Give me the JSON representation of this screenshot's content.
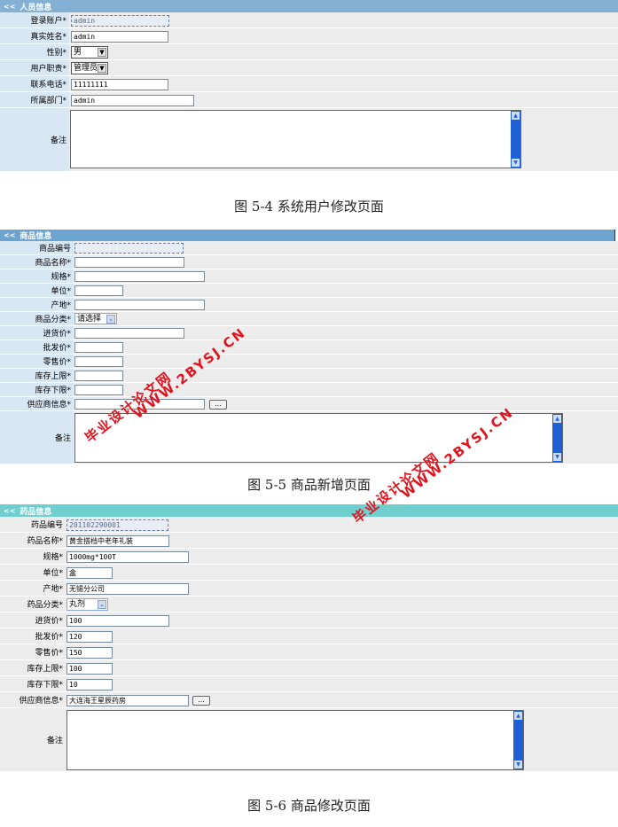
{
  "colors": {
    "header1": "#84b0d3",
    "header2": "#6aa4cf",
    "header3": "#6fcfce",
    "label_bg": "#d7e7f4",
    "value_bg": "#ececec",
    "watermark": "#e0141e"
  },
  "panel1": {
    "title": "人员信息",
    "chevron": "<<",
    "fields": {
      "login": {
        "label": "登录账户*",
        "value": "admin"
      },
      "realname": {
        "label": "真实姓名*",
        "value": "admin"
      },
      "gender": {
        "label": "性别*",
        "value": "男"
      },
      "role": {
        "label": "用户职责*",
        "value": "管理员"
      },
      "phone": {
        "label": "联系电话*",
        "value": "11111111"
      },
      "dept": {
        "label": "所属部门*",
        "value": "admin"
      },
      "remark": {
        "label": "备注"
      }
    }
  },
  "caption1": "图 5-4  系统用户修改页面",
  "panel2": {
    "title": "商品信息",
    "chevron": "<<",
    "fields": {
      "code": {
        "label": "商品编号"
      },
      "name": {
        "label": "商品名称*"
      },
      "spec": {
        "label": "规格*"
      },
      "unit": {
        "label": "单位*"
      },
      "origin": {
        "label": "产地*"
      },
      "category": {
        "label": "商品分类*",
        "value": "请选择"
      },
      "purchase": {
        "label": "进货价*"
      },
      "wholesale": {
        "label": "批发价*"
      },
      "retail": {
        "label": "零售价*"
      },
      "stock_max": {
        "label": "库存上限*"
      },
      "stock_min": {
        "label": "库存下限*"
      },
      "supplier": {
        "label": "供应商信息*",
        "button": "..."
      },
      "remark": {
        "label": "备注"
      }
    }
  },
  "caption2": "图 5-5  商品新增页面",
  "panel3": {
    "title": "药品信息",
    "chevron": "<<",
    "fields": {
      "code": {
        "label": "药品编号",
        "value": "201102290001"
      },
      "name": {
        "label": "药品名称*",
        "value": "黄金搭档中老年礼装"
      },
      "spec": {
        "label": "规格*",
        "value": "1000mg*100T"
      },
      "unit": {
        "label": "单位*",
        "value": "盒"
      },
      "origin": {
        "label": "产地*",
        "value": "无锡分公司"
      },
      "category": {
        "label": "药品分类*",
        "value": "丸剂"
      },
      "purchase": {
        "label": "进货价*",
        "value": "100"
      },
      "wholesale": {
        "label": "批发价*",
        "value": "120"
      },
      "retail": {
        "label": "零售价*",
        "value": "150"
      },
      "stock_max": {
        "label": "库存上限*",
        "value": "100"
      },
      "stock_min": {
        "label": "库存下限*",
        "value": "10"
      },
      "supplier": {
        "label": "供应商信息*",
        "value": "大连海王星辰药房",
        "button": "..."
      },
      "remark": {
        "label": "备注"
      }
    }
  },
  "caption3": "图 5-6  商品修改页面",
  "watermarks": {
    "line1": "毕业设计论文网",
    "line2": "WWW.2BYSJ.CN"
  }
}
